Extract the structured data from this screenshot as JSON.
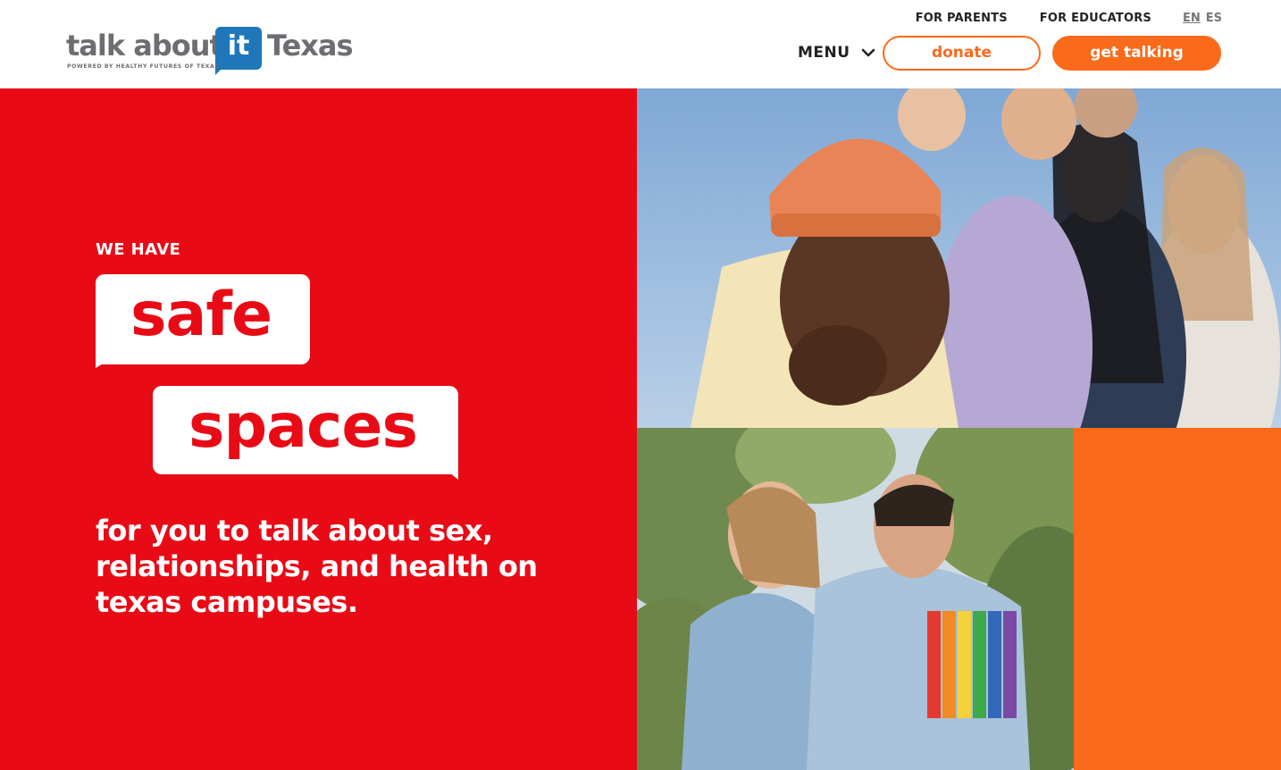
{
  "brand": {
    "main": "talk about",
    "mark": "it",
    "state": "Texas",
    "tagline": "POWERED BY HEALTHY FUTURES OF TEXAS",
    "mark_color": "#1f76b9",
    "text_color": "#6d6e71"
  },
  "nav": {
    "top_links": [
      "FOR PARENTS",
      "FOR EDUCATORS"
    ],
    "languages": {
      "active": "EN",
      "other": "ES"
    },
    "menu_label": "MENU",
    "menu_icon": "chevron-down-icon",
    "donate_label": "donate",
    "cta_label": "get talking"
  },
  "hero": {
    "eyebrow": "WE HAVE",
    "word_1": "safe",
    "word_2": "spaces",
    "body": "for you to talk about sex, relationships, and health on texas campuses.",
    "photos": [
      "group of smiling teenagers photo",
      "couple in denim jackets photo"
    ]
  },
  "colors": {
    "hero_red": "#e80b16",
    "accent_orange": "#f96a1b",
    "text_dark": "#222222"
  }
}
